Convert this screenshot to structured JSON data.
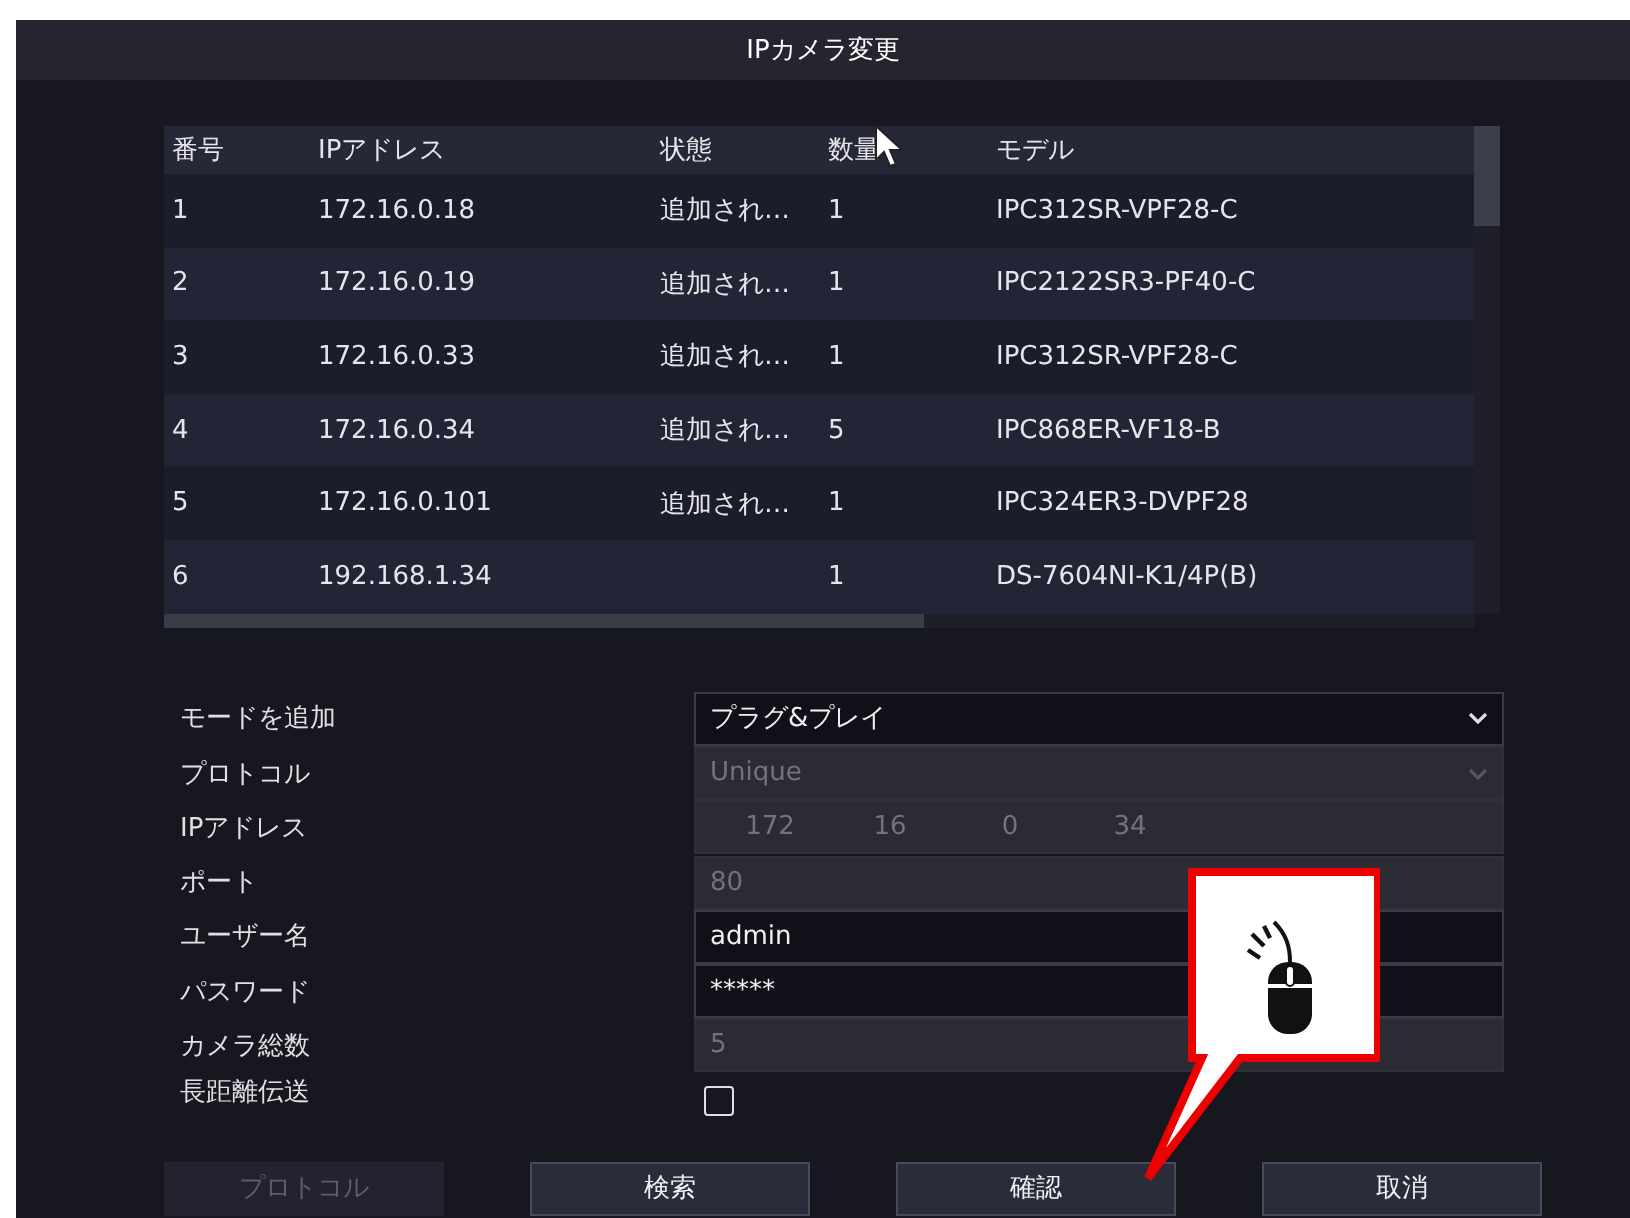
{
  "window": {
    "title": "IPカメラ変更"
  },
  "table": {
    "columns": [
      "番号",
      "IPアドレス",
      "状態",
      "数量",
      "モデル"
    ],
    "rows": [
      {
        "no": "1",
        "ip": "172.16.0.18",
        "status": "追加され…",
        "count": "1",
        "model": "IPC312SR-VPF28-C"
      },
      {
        "no": "2",
        "ip": "172.16.0.19",
        "status": "追加され…",
        "count": "1",
        "model": "IPC2122SR3-PF40-C"
      },
      {
        "no": "3",
        "ip": "172.16.0.33",
        "status": "追加され…",
        "count": "1",
        "model": "IPC312SR-VPF28-C"
      },
      {
        "no": "4",
        "ip": "172.16.0.34",
        "status": "追加され…",
        "count": "5",
        "model": "IPC868ER-VF18-B"
      },
      {
        "no": "5",
        "ip": "172.16.0.101",
        "status": "追加され…",
        "count": "1",
        "model": "IPC324ER3-DVPF28"
      },
      {
        "no": "6",
        "ip": "192.168.1.34",
        "count": "1",
        "model": "DS-7604NI-K1/4P(B)"
      }
    ]
  },
  "form": [
    {
      "kind": "select",
      "label": "モードを追加",
      "value": "プラグ&プレイ",
      "disabled": false
    },
    {
      "kind": "select",
      "label": "プロトコル",
      "value": "Unique",
      "disabled": true
    },
    {
      "kind": "ip",
      "label": "IPアドレス",
      "parts": [
        "172",
        "16",
        "0",
        "34"
      ],
      "disabled": true
    },
    {
      "kind": "text",
      "label": "ポート",
      "value": "80",
      "disabled": true
    },
    {
      "kind": "text",
      "label": "ユーザー名",
      "value": "admin",
      "disabled": false
    },
    {
      "kind": "password",
      "label": "パスワード",
      "value": "*****",
      "disabled": false
    },
    {
      "kind": "text",
      "label": "カメラ総数",
      "value": "5",
      "disabled": true
    },
    {
      "kind": "checkbox",
      "label": "長距離伝送",
      "checked": false
    }
  ],
  "buttons": [
    {
      "label": "プロトコル",
      "disabled": true
    },
    {
      "label": "検索",
      "disabled": false
    },
    {
      "label": "確認",
      "disabled": false
    },
    {
      "label": "取消",
      "disabled": false
    }
  ]
}
